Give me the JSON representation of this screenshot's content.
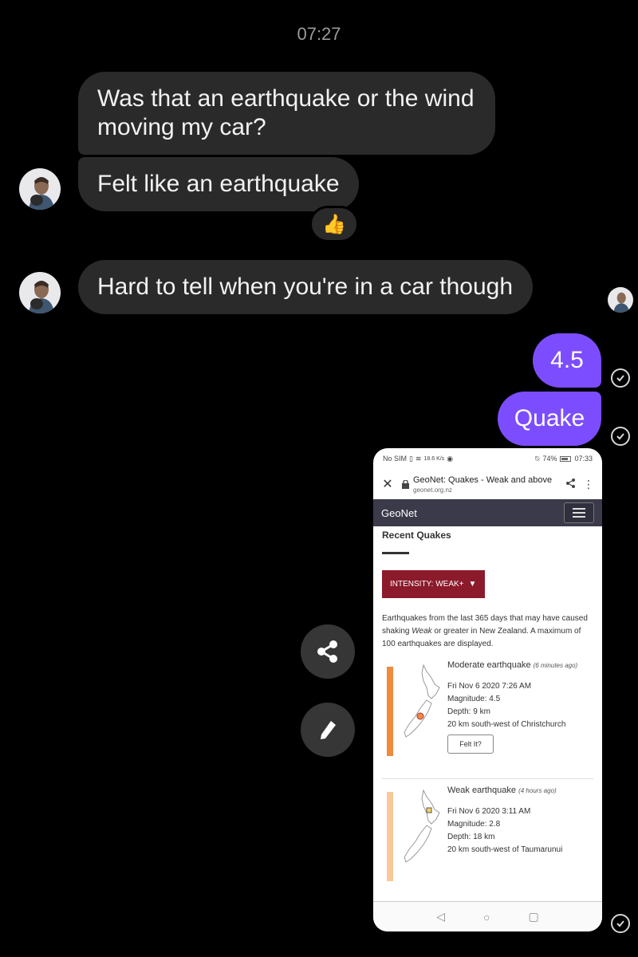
{
  "chat": {
    "timestamp": "07:27",
    "incoming": [
      {
        "text": "Was that an earthquake or the wind moving my car?"
      },
      {
        "text": "Felt like an earthquake",
        "reaction": "👍"
      },
      {
        "text": "Hard to tell when you're in a car though"
      }
    ],
    "outgoing": [
      {
        "text": "4.5"
      },
      {
        "text": "Quake"
      }
    ],
    "actions": {
      "share_icon": "share-icon",
      "edit_icon": "pencil-icon"
    },
    "accent_color": "#7c4dff",
    "bubble_color": "#2a2a2a"
  },
  "screenshot": {
    "status_bar": {
      "carrier": "No SIM",
      "speed": "18.6 K/s",
      "battery": "74%",
      "time": "07:33"
    },
    "browser": {
      "title": "GeoNet: Quakes - Weak and above",
      "domain": "geonet.org.nz"
    },
    "site": {
      "brand": "GeoNet",
      "section_title": "Recent Quakes",
      "filter_label": "INTENSITY: WEAK+",
      "description_before": "Earthquakes from the last 365 days that may have caused shaking ",
      "description_em": "Weak",
      "description_after": " or greater in New Zealand. A maximum of 100 earthquakes are displayed."
    },
    "quakes": [
      {
        "intensity": "Moderate earthquake",
        "ago": "(6 minutes ago)",
        "time": "Fri Nov 6 2020 7:26 AM",
        "magnitude": "Magnitude: 4.5",
        "depth": "Depth: 9 km",
        "location": "20 km south-west of Christchurch",
        "felt_label": "Felt It?",
        "color": "#f08a3c"
      },
      {
        "intensity": "Weak earthquake",
        "ago": "(4 hours ago)",
        "time": "Fri Nov 6 2020 3:11 AM",
        "magnitude": "Magnitude: 2.8",
        "depth": "Depth: 18 km",
        "location": "20 km south-west of Taumarunui",
        "color": "#f8c99a"
      }
    ]
  }
}
